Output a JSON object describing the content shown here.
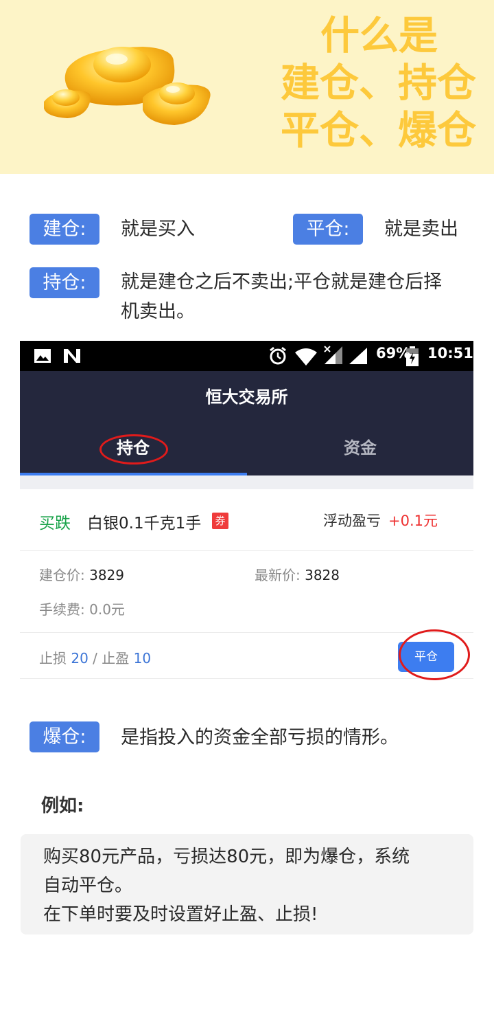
{
  "banner": {
    "title_lines": [
      "什么是",
      "建仓、持仓",
      "平仓、爆仓"
    ],
    "art_icon": "gold-ingots-icon",
    "colors": {
      "background": "#fdf4c7",
      "title": "#fdc93c"
    }
  },
  "definitions": {
    "open": {
      "tag": "建仓:",
      "text": "就是买入"
    },
    "close": {
      "tag": "平仓:",
      "text": "就是卖出"
    },
    "hold": {
      "tag": "持仓:",
      "text_line1": "就是建仓之后不卖出;平仓就是建仓后择",
      "text_line2": "机卖出。"
    },
    "liquidation": {
      "tag": "爆仓:",
      "text": "是指投入的资金全部亏损的情形。"
    }
  },
  "phone": {
    "status_bar": {
      "battery": "69%",
      "time": "10:51",
      "icons": [
        "image-icon",
        "n-logo-icon",
        "alarm-icon",
        "wifi-icon",
        "signal-icon",
        "battery-icon"
      ]
    },
    "app_title": "恒大交易所",
    "tabs": [
      {
        "label": "持仓",
        "active": true
      },
      {
        "label": "资金",
        "active": false
      }
    ],
    "position": {
      "direction": "买跌",
      "product": "白银0.1千克1手",
      "coupon_badge": "券",
      "pnl_label": "浮动盈亏",
      "pnl_value": "+0.1元",
      "open_price_label": "建仓价:",
      "open_price_value": "3829",
      "latest_price_label": "最新价:",
      "latest_price_value": "3828",
      "fee_label": "手续费:",
      "fee_value": "0.0元",
      "stop_loss_label": "止损",
      "stop_loss_value": "20",
      "stops_separator": "/",
      "take_profit_label": "止盈",
      "take_profit_value": "10",
      "close_button": "平仓"
    },
    "colors": {
      "appbar": "#24273d",
      "accent": "#3d7df0",
      "buy_down": "#1aa34a",
      "pnl": "#ee2f2f",
      "highlight_circle": "#e01b1b"
    }
  },
  "example": {
    "heading": "例如:",
    "lines": [
      "购买80元产品，亏损达80元，即为爆仓，系统",
      "自动平仓。",
      "在下单时要及时设置好止盈、止损!"
    ]
  },
  "colors": {
    "tag": "#4b7fe3"
  }
}
